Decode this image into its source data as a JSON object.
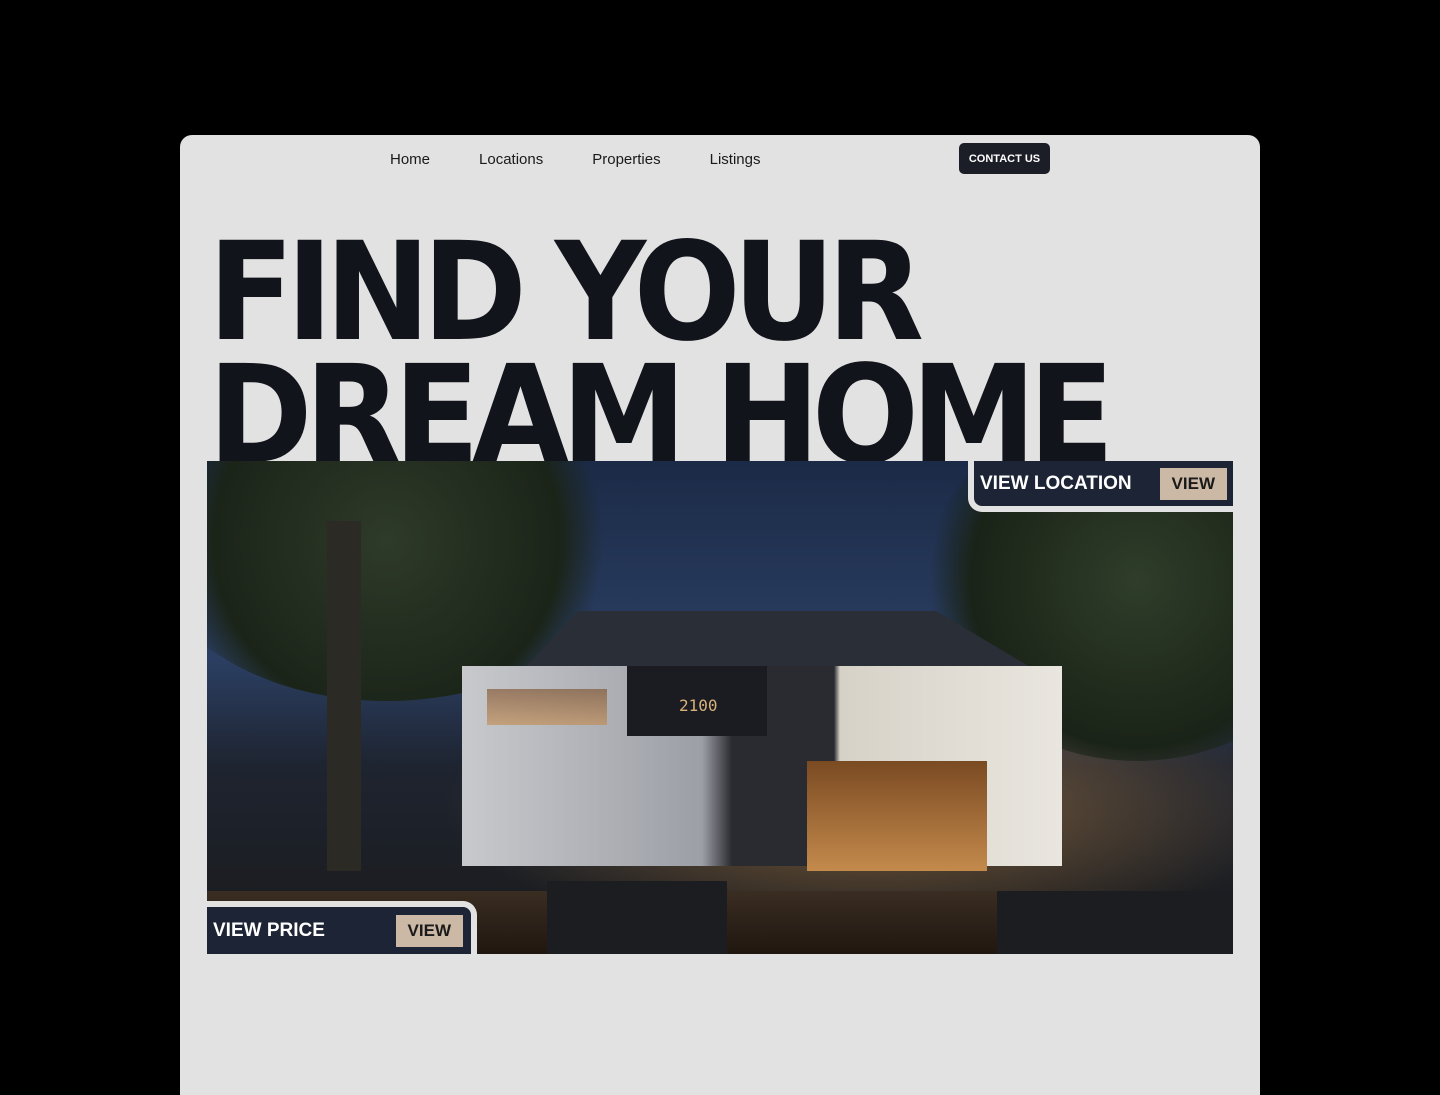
{
  "nav": {
    "items": [
      "Home",
      "Locations",
      "Properties",
      "Listings"
    ],
    "contact_label": "CONTACT US"
  },
  "hero": {
    "headline_line1": "FIND YOUR",
    "headline_line2": "DREAM HOME",
    "image_sign": "2100",
    "location_tag": {
      "label": "VIEW LOCATION",
      "button": "VIEW"
    },
    "price_tag": {
      "label": "VIEW PRICE",
      "button": "VIEW"
    }
  },
  "colors": {
    "background": "#000000",
    "page": "#e2e2e2",
    "dark": "#12141c",
    "tag": "#1d2435",
    "accent": "#cbb8a5"
  }
}
